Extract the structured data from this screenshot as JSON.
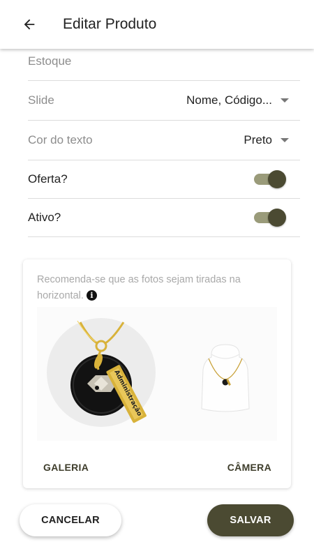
{
  "header": {
    "title": "Editar Produto",
    "back_icon": "arrow-left-icon"
  },
  "form": {
    "stock_label": "Estoque",
    "slide_label": "Slide",
    "slide_value": "Nome, Código...",
    "text_color_label": "Cor do texto",
    "text_color_value": "Preto",
    "offer_label": "Oferta?",
    "offer_on": true,
    "active_label": "Ativo?",
    "active_on": true
  },
  "photos": {
    "hint": "Recomenda-se que as fotos sejam tiradas na horizontal.",
    "info_icon": "info-icon",
    "images": [
      "pendant-photo",
      "necklace-bust-photo"
    ],
    "gallery_label": "GALERIA",
    "camera_label": "CÂMERA"
  },
  "actions": {
    "cancel_label": "CANCELAR",
    "save_label": "SALVAR"
  },
  "colors": {
    "accent": "#4b4a32",
    "toggle_track": "#9a9b7a",
    "muted_text": "#8d8d8d"
  }
}
